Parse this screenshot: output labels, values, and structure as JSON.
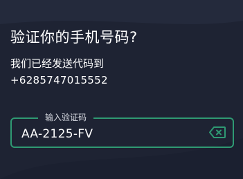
{
  "verification": {
    "title": "验证你的手机号码?",
    "sent_text": "我们已经发送代码到",
    "phone_number": "+6285747015552",
    "code_field": {
      "label": "输入验证码",
      "value": "AA-2125-FV"
    }
  },
  "icons": {
    "clear": "backspace-clear-icon"
  },
  "colors": {
    "background": "#1e2333",
    "accent": "#2f9a73",
    "text": "#ffffff",
    "label": "#d6d9e0"
  }
}
